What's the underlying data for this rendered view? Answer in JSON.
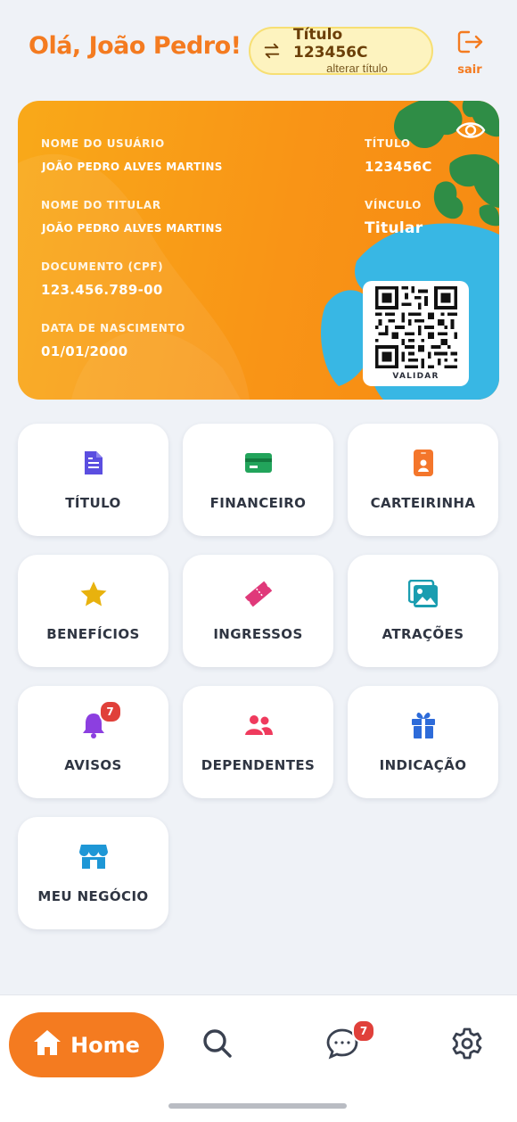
{
  "header": {
    "greeting": "Olá, João Pedro!",
    "title_switch": {
      "title": "Título 123456C",
      "subtitle": "alterar título"
    },
    "logout_label": "sair"
  },
  "card": {
    "user_name_label": "NOME DO USUÁRIO",
    "user_name": "JOÃO PEDRO ALVES MARTINS",
    "holder_name_label": "NOME DO TITULAR",
    "holder_name": "JOÃO PEDRO ALVES MARTINS",
    "document_label": "DOCUMENTO (CPF)",
    "document": "123.456.789-00",
    "birth_label": "DATA DE NASCIMENTO",
    "birth": "01/01/2000",
    "title_label": "TÍTULO",
    "title": "123456C",
    "bond_label": "VÍNCULO",
    "bond": "Titular",
    "qr_label": "VALIDAR"
  },
  "menu": {
    "titulo": "TÍTULO",
    "financeiro": "FINANCEIRO",
    "carteirinha": "CARTEIRINHA",
    "beneficios": "BENEFÍCIOS",
    "ingressos": "INGRESSOS",
    "atracoes": "ATRAÇÕES",
    "avisos": "AVISOS",
    "avisos_badge": "7",
    "dependentes": "DEPENDENTES",
    "indicacao": "INDICAÇÃO",
    "meu_negocio": "MEU NEGÓCIO"
  },
  "bottom_nav": {
    "home_label": "Home",
    "chat_badge": "7",
    "icons": [
      "home-icon",
      "search-icon",
      "chat-icon",
      "settings-icon"
    ]
  },
  "colors": {
    "accent": "#f47b20",
    "card_orange": "#f99416",
    "badge_red": "#e0403a"
  }
}
